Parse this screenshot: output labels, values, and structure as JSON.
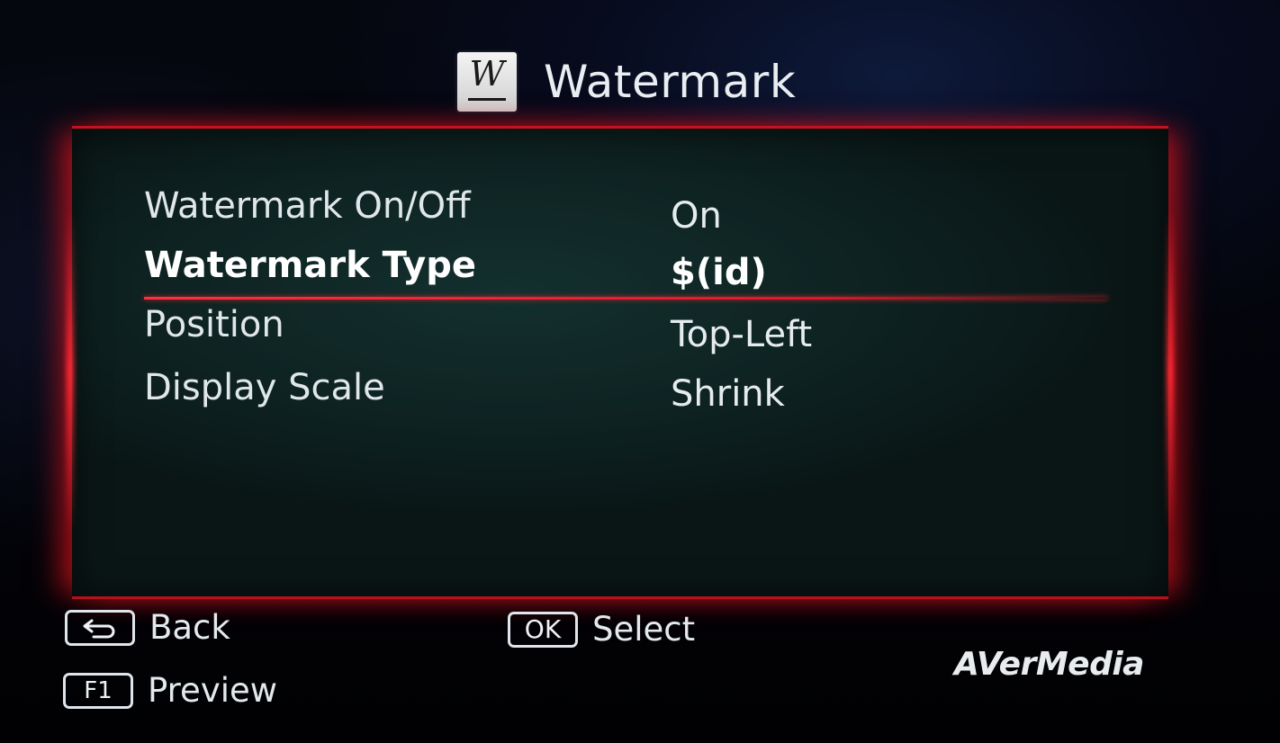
{
  "header": {
    "icon": "watermark-w-icon",
    "title": "Watermark"
  },
  "menu": {
    "items": [
      {
        "label": "Watermark On/Off",
        "value": "On"
      },
      {
        "label": "Watermark Type",
        "value": "$(id)"
      },
      {
        "label": "Position",
        "value": "Top-Left"
      },
      {
        "label": "Display Scale",
        "value": "Shrink"
      }
    ],
    "selected_index": 1
  },
  "footer": {
    "back": {
      "key_icon": "return-arrow-icon",
      "label": "Back"
    },
    "preview": {
      "key": "F1",
      "label": "Preview"
    },
    "select": {
      "key": "OK",
      "label": "Select"
    },
    "brand": "AVerMedia"
  },
  "colors": {
    "accent": "#c41220",
    "panel_bg": "#0e2322",
    "text": "#e6ecee"
  }
}
